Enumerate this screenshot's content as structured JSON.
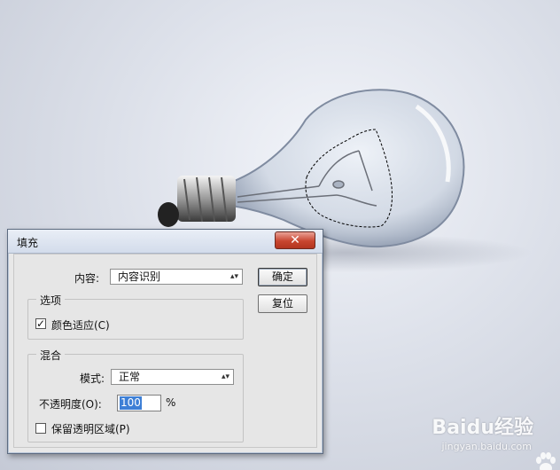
{
  "dialog": {
    "title": "填充",
    "close_glyph": "✕",
    "content_label": "内容:",
    "content_value": "内容识别",
    "ok_label": "确定",
    "reset_label": "复位",
    "options_legend": "选项",
    "color_adapt_label": "颜色适应(C)",
    "color_adapt_checked": true,
    "blend_legend": "混合",
    "mode_label": "模式:",
    "mode_value": "正常",
    "opacity_label": "不透明度(O):",
    "opacity_value": "100",
    "opacity_unit": "%",
    "preserve_transparency_label": "保留透明区域(P)",
    "preserve_transparency_checked": false,
    "checkmark_glyph": "✓",
    "dropdown_glyph": "▴▾"
  },
  "watermark": {
    "brand": "Baidu经验",
    "url": "jingyan.baidu.com",
    "icon": "baidu-paw-icon"
  },
  "colors": {
    "dialog_bg": "#e6e6e6",
    "close_button": "#c8452f",
    "selection_highlight": "#3d7fd6"
  }
}
